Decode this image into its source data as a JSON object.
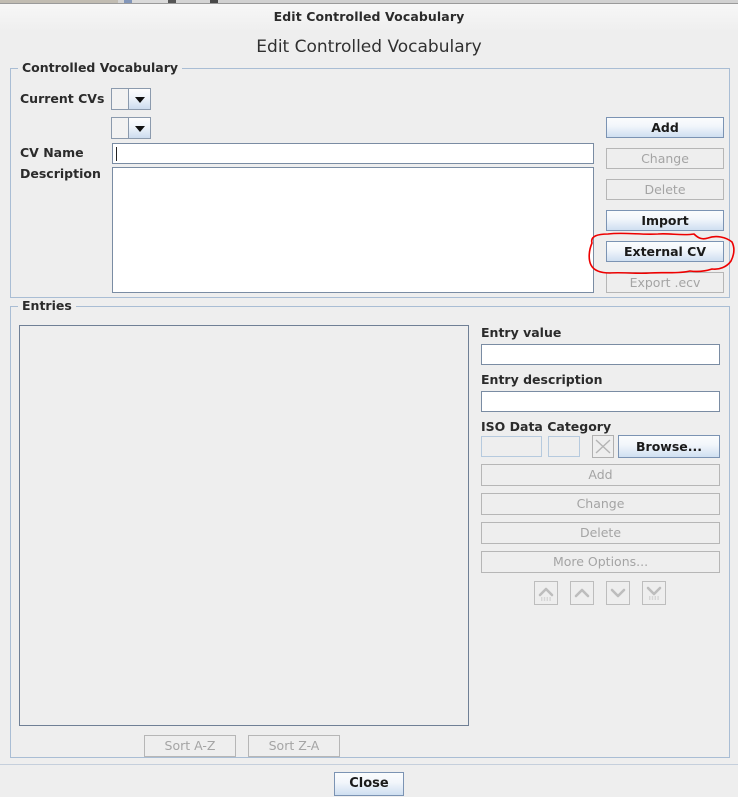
{
  "window": {
    "title": "Edit Controlled Vocabulary"
  },
  "dialog": {
    "heading": "Edit Controlled Vocabulary"
  },
  "cv_group": {
    "title": "Controlled Vocabulary",
    "current_cvs_label": "Current CVs",
    "cv_name_label": "CV Name",
    "description_label": "Description",
    "current_cv_value": "",
    "secondary_cv_value": "",
    "cv_name_value": "",
    "cv_name_placeholder": "",
    "description_value": "",
    "buttons": [
      {
        "label": "Add",
        "enabled": true
      },
      {
        "label": "Change",
        "enabled": false
      },
      {
        "label": "Delete",
        "enabled": false
      },
      {
        "label": "Import",
        "enabled": true
      },
      {
        "label": "External CV",
        "enabled": true
      },
      {
        "label": "Export .ecv",
        "enabled": false
      }
    ]
  },
  "entries_group": {
    "title": "Entries",
    "list_items": [],
    "entry_value_label": "Entry value",
    "entry_value": "",
    "entry_description_label": "Entry description",
    "entry_description": "",
    "iso_data_category_label": "ISO Data Category",
    "iso_code": "",
    "iso_short": "",
    "clear_icon": "close-x-icon",
    "browse_label": "Browse...",
    "action_buttons": [
      {
        "label": "Add",
        "enabled": false
      },
      {
        "label": "Change",
        "enabled": false
      },
      {
        "label": "Delete",
        "enabled": false
      },
      {
        "label": "More Options...",
        "enabled": false
      }
    ],
    "move_buttons": [
      {
        "icon": "move-to-top-icon",
        "enabled": false
      },
      {
        "icon": "move-up-icon",
        "enabled": false
      },
      {
        "icon": "move-down-icon",
        "enabled": false
      },
      {
        "icon": "move-to-bottom-icon",
        "enabled": false
      }
    ],
    "sort_az_label": "Sort A-Z",
    "sort_za_label": "Sort Z-A"
  },
  "footer": {
    "close_label": "Close"
  },
  "annotation": {
    "type": "hand-drawn-ellipse",
    "color": "#ee0000",
    "target": "External CV"
  },
  "colors": {
    "background": "#eeeeee",
    "panel_border": "#a9bdd4",
    "button_accent": "#cfdff1",
    "disabled_text": "#a4a4a4",
    "annotation_red": "#ee0000"
  }
}
